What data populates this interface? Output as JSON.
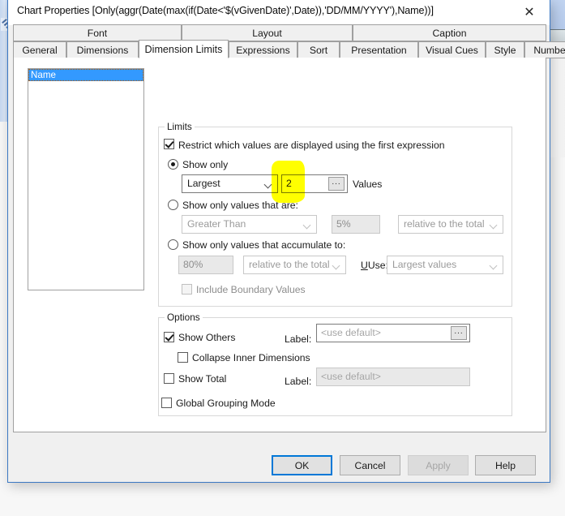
{
  "dialog": {
    "title": "Chart Properties [Only(aggr(Date(max(if(Date<'$(vGivenDate)',Date)),'DD/MM/YYYY'),Name))]",
    "close_icon": "close-icon",
    "close_glyph": "✕"
  },
  "tabs": {
    "row_top": [
      {
        "label": "Font"
      },
      {
        "label": "Layout"
      },
      {
        "label": "Caption"
      }
    ],
    "row_bottom": [
      {
        "label": "General",
        "active": false
      },
      {
        "label": "Dimensions",
        "active": false
      },
      {
        "label": "Dimension Limits",
        "active": true
      },
      {
        "label": "Expressions",
        "active": false
      },
      {
        "label": "Sort",
        "active": false
      },
      {
        "label": "Presentation",
        "active": false
      },
      {
        "label": "Visual Cues",
        "active": false
      },
      {
        "label": "Style",
        "active": false
      },
      {
        "label": "Number",
        "active": false
      }
    ]
  },
  "dimension_list": {
    "items": [
      {
        "label": "Name",
        "selected": true
      }
    ]
  },
  "limits": {
    "group_label": "Limits",
    "restrict_checkbox": {
      "label": "Restrict which values are displayed using the first expression",
      "checked": true
    },
    "show_only": {
      "label": "Show only",
      "selected": true,
      "rank_select": "Largest",
      "count_value": "2",
      "ellipsis_label": "...",
      "values_label": "Values",
      "highlighted": true
    },
    "show_only_values_that_are": {
      "label": "Show only values that are:",
      "selected": false,
      "operator_select": "Greater Than",
      "threshold_value": "5%",
      "basis_select": "relative to the total"
    },
    "show_only_values_accumulate": {
      "label": "Show only values that accumulate to:",
      "selected": false,
      "accumulate_value": "80%",
      "basis_select": "relative to the total",
      "use_label": "Use:",
      "use_select": "Largest values"
    },
    "include_boundary": {
      "label": "Include Boundary Values",
      "checked": false,
      "disabled": true
    }
  },
  "options": {
    "group_label": "Options",
    "show_others": {
      "label": "Show Others",
      "checked": true,
      "label_caption": "Label:",
      "label_value": "<use default>",
      "ellipsis_label": "..."
    },
    "collapse_inner": {
      "label": "Collapse Inner Dimensions",
      "checked": false
    },
    "show_total": {
      "label": "Show Total",
      "checked": false,
      "label_caption": "Label:",
      "label_value": "<use default>"
    },
    "global_grouping": {
      "label": "Global Grouping Mode",
      "checked": false
    }
  },
  "footer": {
    "ok": "OK",
    "cancel": "Cancel",
    "apply": "Apply",
    "help": "Help"
  },
  "colors": {
    "accent": "#0078d7",
    "selection": "#3399ff",
    "highlighter": "#ffff00",
    "dialog_border": "#3b78c3"
  }
}
